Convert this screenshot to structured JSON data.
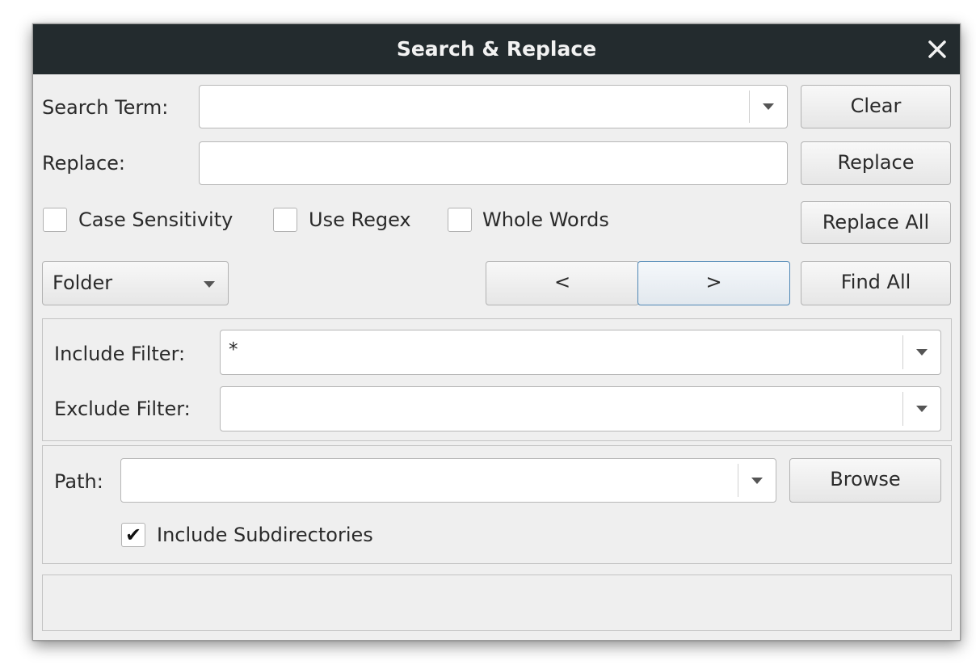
{
  "window": {
    "title": "Search & Replace",
    "close_icon": "close-icon"
  },
  "search": {
    "label": "Search Term:",
    "value": "",
    "clear_label": "Clear"
  },
  "replace": {
    "label": "Replace:",
    "value": "",
    "replace_label": "Replace",
    "replace_all_label": "Replace All"
  },
  "options": {
    "case_sensitivity": {
      "label": "Case Sensitivity",
      "checked": false
    },
    "use_regex": {
      "label": "Use Regex",
      "checked": false
    },
    "whole_words": {
      "label": "Whole Words",
      "checked": false
    }
  },
  "scope": {
    "selected": "Folder"
  },
  "navigation": {
    "prev_label": "<",
    "next_label": ">",
    "find_all_label": "Find All"
  },
  "filters": {
    "include_label": "Include Filter:",
    "include_value": "*",
    "exclude_label": "Exclude Filter:",
    "exclude_value": ""
  },
  "path": {
    "label": "Path:",
    "value": "",
    "browse_label": "Browse",
    "include_subdirs_label": "Include Subdirectories",
    "include_subdirs_checked": true,
    "include_subdirs_mark": "✔"
  },
  "status": {
    "text": ""
  },
  "colors": {
    "titlebar": "#232b2e",
    "dialog_bg": "#efefef",
    "focus_border": "#4f87b5"
  }
}
